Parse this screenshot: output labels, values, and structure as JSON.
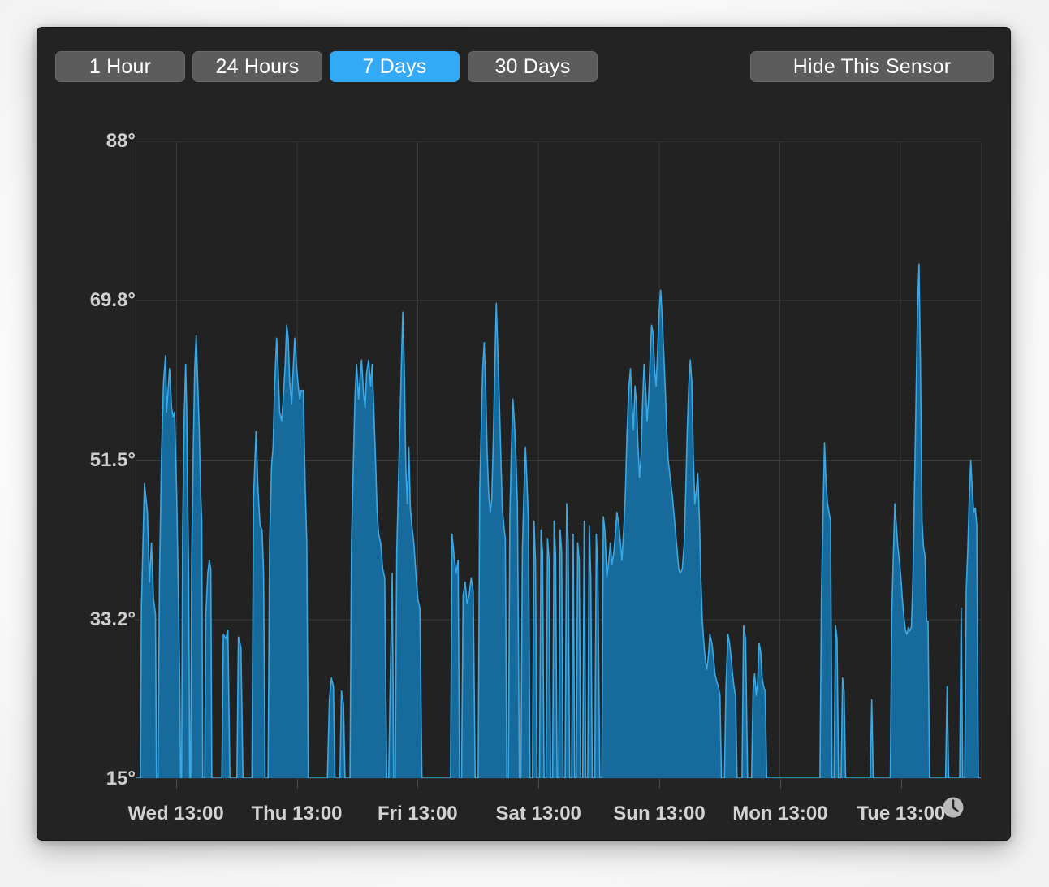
{
  "window": {
    "background_color": "#232323",
    "panel_color": "#222222"
  },
  "toolbar": {
    "range_buttons": [
      {
        "label": "1 Hour",
        "active": false
      },
      {
        "label": "24 Hours",
        "active": false
      },
      {
        "label": "7 Days",
        "active": true
      },
      {
        "label": "30 Days",
        "active": false
      }
    ],
    "hide_sensor_label": "Hide This Sensor",
    "active_color": "#34aaf6",
    "inactive_color": "#5c5c5c"
  },
  "chart_data": {
    "type": "area",
    "title": "",
    "xlabel": "",
    "ylabel": "",
    "grid": true,
    "legend": "none",
    "series_fill_color": "#176a9c",
    "series_line_color": "#3aa8e4",
    "ylim": [
      15,
      88
    ],
    "ytick_labels": [
      "88°",
      "69.8°",
      "51.5°",
      "33.2°",
      "15°"
    ],
    "ytick_values": [
      88,
      69.8,
      51.5,
      33.2,
      15
    ],
    "xtick_labels": [
      "Wed 13:00",
      "Thu 13:00",
      "Fri 13:00",
      "Sat 13:00",
      "Sun 13:00",
      "Mon 13:00",
      "Tue 13:00"
    ],
    "xtick_positions": [
      0.0476,
      0.1905,
      0.3333,
      0.4762,
      0.619,
      0.7619,
      0.9048
    ],
    "x_units": "hours since Wed 00:00",
    "xlim": [
      0,
      168
    ],
    "baseline": 15,
    "points": [
      [
        0.0,
        15
      ],
      [
        0.8,
        15
      ],
      [
        1.0,
        34.5
      ],
      [
        1.6,
        48.8
      ],
      [
        2.2,
        45.5
      ],
      [
        2.6,
        37.5
      ],
      [
        3.0,
        42.0
      ],
      [
        3.4,
        35.6
      ],
      [
        3.8,
        33.8
      ],
      [
        4.0,
        15
      ],
      [
        4.3,
        15
      ],
      [
        4.6,
        38.0
      ],
      [
        5.0,
        52.0
      ],
      [
        5.4,
        60.5
      ],
      [
        5.8,
        63.5
      ],
      [
        6.0,
        57.0
      ],
      [
        6.3,
        59.5
      ],
      [
        6.6,
        62.0
      ],
      [
        7.0,
        57.5
      ],
      [
        7.3,
        56.5
      ],
      [
        7.6,
        57.0
      ],
      [
        8.0,
        48.0
      ],
      [
        8.3,
        38.0
      ],
      [
        8.6,
        27.0
      ],
      [
        8.8,
        15
      ],
      [
        9.0,
        15
      ],
      [
        9.2,
        43.0
      ],
      [
        9.5,
        56.0
      ],
      [
        9.8,
        62.5
      ],
      [
        10.0,
        57.5
      ],
      [
        10.2,
        47.5
      ],
      [
        10.4,
        38.0
      ],
      [
        10.6,
        15
      ],
      [
        10.8,
        15
      ],
      [
        11.0,
        40.0
      ],
      [
        11.3,
        52.0
      ],
      [
        11.6,
        62.0
      ],
      [
        11.9,
        65.8
      ],
      [
        12.2,
        60.5
      ],
      [
        12.5,
        55.0
      ],
      [
        12.8,
        47.5
      ],
      [
        13.0,
        44.5
      ],
      [
        13.2,
        15
      ],
      [
        13.6,
        15
      ],
      [
        13.8,
        33.5
      ],
      [
        14.2,
        38.5
      ],
      [
        14.5,
        40.0
      ],
      [
        14.8,
        39.0
      ],
      [
        15.0,
        15
      ],
      [
        17.0,
        15
      ],
      [
        17.3,
        31.5
      ],
      [
        17.8,
        31.0
      ],
      [
        18.2,
        32.0
      ],
      [
        18.6,
        15
      ],
      [
        20.0,
        15
      ],
      [
        20.3,
        31.2
      ],
      [
        20.8,
        30.0
      ],
      [
        21.2,
        15
      ],
      [
        23.0,
        15
      ],
      [
        23.3,
        47.0
      ],
      [
        23.8,
        54.8
      ],
      [
        24.2,
        48.0
      ],
      [
        24.6,
        44.0
      ],
      [
        25.0,
        43.5
      ],
      [
        25.3,
        38.5
      ],
      [
        25.6,
        15
      ],
      [
        26.2,
        15
      ],
      [
        26.5,
        42.0
      ],
      [
        26.9,
        51.0
      ],
      [
        27.2,
        53.0
      ],
      [
        27.5,
        60.0
      ],
      [
        27.9,
        65.5
      ],
      [
        28.2,
        62.0
      ],
      [
        28.5,
        57.0
      ],
      [
        28.9,
        56.0
      ],
      [
        29.2,
        58.5
      ],
      [
        29.6,
        62.5
      ],
      [
        29.9,
        67.0
      ],
      [
        30.2,
        65.5
      ],
      [
        30.5,
        60.5
      ],
      [
        30.9,
        58.0
      ],
      [
        31.2,
        62.0
      ],
      [
        31.5,
        65.5
      ],
      [
        31.9,
        62.0
      ],
      [
        32.2,
        60.0
      ],
      [
        32.5,
        58.5
      ],
      [
        32.8,
        59.5
      ],
      [
        33.2,
        59.5
      ],
      [
        33.6,
        48.0
      ],
      [
        33.9,
        42.0
      ],
      [
        34.2,
        15
      ],
      [
        38.0,
        15
      ],
      [
        38.4,
        24.0
      ],
      [
        38.8,
        26.5
      ],
      [
        39.2,
        25.5
      ],
      [
        39.5,
        15
      ],
      [
        40.5,
        15
      ],
      [
        40.8,
        25.0
      ],
      [
        41.2,
        23.5
      ],
      [
        41.5,
        15
      ],
      [
        42.5,
        15
      ],
      [
        42.8,
        42.0
      ],
      [
        43.2,
        52.0
      ],
      [
        43.5,
        59.0
      ],
      [
        43.8,
        62.5
      ],
      [
        44.2,
        58.5
      ],
      [
        44.5,
        61.0
      ],
      [
        44.8,
        63.0
      ],
      [
        45.2,
        59.0
      ],
      [
        45.5,
        57.5
      ],
      [
        45.8,
        61.5
      ],
      [
        46.2,
        63.0
      ],
      [
        46.6,
        60.0
      ],
      [
        46.9,
        62.5
      ],
      [
        47.2,
        58.0
      ],
      [
        47.6,
        51.0
      ],
      [
        47.9,
        45.5
      ],
      [
        48.2,
        43.0
      ],
      [
        48.6,
        42.0
      ],
      [
        49.0,
        39.0
      ],
      [
        49.4,
        38.0
      ],
      [
        49.8,
        15
      ],
      [
        50.2,
        15
      ],
      [
        50.5,
        26.0
      ],
      [
        50.9,
        38.5
      ],
      [
        51.2,
        15
      ],
      [
        51.5,
        15
      ],
      [
        51.8,
        41.0
      ],
      [
        52.1,
        48.0
      ],
      [
        52.4,
        55.0
      ],
      [
        52.7,
        62.0
      ],
      [
        53.0,
        68.5
      ],
      [
        53.3,
        62.0
      ],
      [
        53.6,
        50.5
      ],
      [
        53.9,
        46.5
      ],
      [
        54.2,
        53.0
      ],
      [
        54.5,
        46.0
      ],
      [
        54.8,
        44.0
      ],
      [
        55.2,
        42.0
      ],
      [
        55.6,
        38.5
      ],
      [
        56.0,
        35.5
      ],
      [
        56.4,
        34.5
      ],
      [
        56.8,
        15
      ],
      [
        62.5,
        15
      ],
      [
        62.8,
        43.0
      ],
      [
        63.2,
        40.5
      ],
      [
        63.6,
        38.5
      ],
      [
        64.0,
        40.0
      ],
      [
        64.3,
        15
      ],
      [
        64.7,
        15
      ],
      [
        65.0,
        36.0
      ],
      [
        65.4,
        37.5
      ],
      [
        65.8,
        35.0
      ],
      [
        66.2,
        36.0
      ],
      [
        66.6,
        38.0
      ],
      [
        67.0,
        36.5
      ],
      [
        67.4,
        15
      ],
      [
        68.0,
        15
      ],
      [
        68.3,
        48.0
      ],
      [
        68.6,
        55.0
      ],
      [
        68.9,
        62.0
      ],
      [
        69.2,
        65.0
      ],
      [
        69.5,
        59.5
      ],
      [
        69.8,
        52.0
      ],
      [
        70.1,
        47.5
      ],
      [
        70.4,
        45.5
      ],
      [
        70.7,
        47.0
      ],
      [
        71.0,
        53.5
      ],
      [
        71.3,
        62.0
      ],
      [
        71.6,
        69.5
      ],
      [
        71.9,
        64.0
      ],
      [
        72.2,
        58.5
      ],
      [
        72.5,
        52.0
      ],
      [
        72.8,
        46.0
      ],
      [
        73.1,
        44.0
      ],
      [
        73.4,
        42.5
      ],
      [
        73.7,
        15
      ],
      [
        74.0,
        15
      ],
      [
        74.3,
        45.0
      ],
      [
        74.6,
        52.5
      ],
      [
        74.9,
        58.5
      ],
      [
        75.2,
        56.0
      ],
      [
        75.5,
        52.0
      ],
      [
        75.8,
        46.5
      ],
      [
        76.2,
        15
      ],
      [
        76.5,
        15
      ],
      [
        76.8,
        41.5
      ],
      [
        77.1,
        47.5
      ],
      [
        77.4,
        53.0
      ],
      [
        77.7,
        49.0
      ],
      [
        78.0,
        44.5
      ],
      [
        78.3,
        15
      ],
      [
        78.8,
        15
      ],
      [
        79.1,
        44.5
      ],
      [
        79.4,
        40.0
      ],
      [
        79.7,
        15
      ],
      [
        80.2,
        15
      ],
      [
        80.5,
        43.5
      ],
      [
        80.8,
        41.0
      ],
      [
        81.1,
        15
      ],
      [
        81.5,
        15
      ],
      [
        81.8,
        42.5
      ],
      [
        82.1,
        40.0
      ],
      [
        82.4,
        15
      ],
      [
        82.8,
        15
      ],
      [
        83.1,
        44.5
      ],
      [
        83.4,
        40.5
      ],
      [
        83.7,
        15
      ],
      [
        84.0,
        15
      ],
      [
        84.3,
        43.5
      ],
      [
        84.6,
        41.0
      ],
      [
        84.9,
        15
      ],
      [
        85.3,
        15
      ],
      [
        85.6,
        46.5
      ],
      [
        85.9,
        42.0
      ],
      [
        86.2,
        15
      ],
      [
        86.6,
        15
      ],
      [
        86.9,
        43.0
      ],
      [
        87.2,
        15
      ],
      [
        87.5,
        15
      ],
      [
        87.8,
        42.0
      ],
      [
        88.1,
        40.0
      ],
      [
        88.4,
        15
      ],
      [
        88.8,
        15
      ],
      [
        89.1,
        44.5
      ],
      [
        89.4,
        15
      ],
      [
        89.8,
        15
      ],
      [
        90.1,
        44.0
      ],
      [
        90.4,
        38.0
      ],
      [
        90.7,
        15
      ],
      [
        91.2,
        15
      ],
      [
        91.5,
        43.0
      ],
      [
        91.8,
        39.0
      ],
      [
        92.2,
        15
      ],
      [
        92.6,
        15
      ],
      [
        92.9,
        45.0
      ],
      [
        93.2,
        43.5
      ],
      [
        93.6,
        38.0
      ],
      [
        94.0,
        40.0
      ],
      [
        94.3,
        42.0
      ],
      [
        94.6,
        39.5
      ],
      [
        95.0,
        41.0
      ],
      [
        95.3,
        43.0
      ],
      [
        95.6,
        45.5
      ],
      [
        96.0,
        44.0
      ],
      [
        96.3,
        42.0
      ],
      [
        96.6,
        40.0
      ],
      [
        97.0,
        44.0
      ],
      [
        97.3,
        48.0
      ],
      [
        97.6,
        54.5
      ],
      [
        98.0,
        60.0
      ],
      [
        98.3,
        62.0
      ],
      [
        98.6,
        58.0
      ],
      [
        98.9,
        55.0
      ],
      [
        99.2,
        60.0
      ],
      [
        99.5,
        58.0
      ],
      [
        99.8,
        53.0
      ],
      [
        100.1,
        49.5
      ],
      [
        100.4,
        52.0
      ],
      [
        100.7,
        58.0
      ],
      [
        101.0,
        62.5
      ],
      [
        101.3,
        60.0
      ],
      [
        101.6,
        56.0
      ],
      [
        101.9,
        58.5
      ],
      [
        102.2,
        63.0
      ],
      [
        102.5,
        67.0
      ],
      [
        102.8,
        66.0
      ],
      [
        103.1,
        62.0
      ],
      [
        103.4,
        60.0
      ],
      [
        103.7,
        64.0
      ],
      [
        104.0,
        68.5
      ],
      [
        104.3,
        71.0
      ],
      [
        104.6,
        68.0
      ],
      [
        104.9,
        64.0
      ],
      [
        105.2,
        60.0
      ],
      [
        105.5,
        55.0
      ],
      [
        105.8,
        51.5
      ],
      [
        106.1,
        50.0
      ],
      [
        106.4,
        48.5
      ],
      [
        106.7,
        47.0
      ],
      [
        107.0,
        45.0
      ],
      [
        107.3,
        43.0
      ],
      [
        107.6,
        41.0
      ],
      [
        107.9,
        39.0
      ],
      [
        108.2,
        38.5
      ],
      [
        108.6,
        39.0
      ],
      [
        109.0,
        42.0
      ],
      [
        109.3,
        48.0
      ],
      [
        109.6,
        55.0
      ],
      [
        109.9,
        60.0
      ],
      [
        110.2,
        63.0
      ],
      [
        110.5,
        60.5
      ],
      [
        110.8,
        52.0
      ],
      [
        111.1,
        46.5
      ],
      [
        111.4,
        48.0
      ],
      [
        111.7,
        50.0
      ],
      [
        112.0,
        45.0
      ],
      [
        112.3,
        38.0
      ],
      [
        112.6,
        33.0
      ],
      [
        112.9,
        30.5
      ],
      [
        113.2,
        28.5
      ],
      [
        113.5,
        27.5
      ],
      [
        113.8,
        29.0
      ],
      [
        114.1,
        31.5
      ],
      [
        114.5,
        30.5
      ],
      [
        114.8,
        29.0
      ],
      [
        115.1,
        27.0
      ],
      [
        115.5,
        26.0
      ],
      [
        115.8,
        25.5
      ],
      [
        116.1,
        24.5
      ],
      [
        116.4,
        15
      ],
      [
        117.0,
        15
      ],
      [
        117.3,
        25.5
      ],
      [
        117.7,
        31.5
      ],
      [
        118.0,
        30.5
      ],
      [
        118.3,
        29.0
      ],
      [
        118.6,
        27.0
      ],
      [
        118.9,
        25.5
      ],
      [
        119.2,
        24.5
      ],
      [
        119.5,
        15
      ],
      [
        120.5,
        15
      ],
      [
        120.8,
        32.5
      ],
      [
        121.2,
        31.0
      ],
      [
        121.6,
        15
      ],
      [
        122.4,
        15
      ],
      [
        122.7,
        25.0
      ],
      [
        123.0,
        27.0
      ],
      [
        123.3,
        24.5
      ],
      [
        123.6,
        26.0
      ],
      [
        123.9,
        30.5
      ],
      [
        124.2,
        29.5
      ],
      [
        124.5,
        26.5
      ],
      [
        124.8,
        25.5
      ],
      [
        125.1,
        25.0
      ],
      [
        125.4,
        15
      ],
      [
        136.0,
        15
      ],
      [
        136.3,
        36.0
      ],
      [
        136.6,
        45.0
      ],
      [
        136.9,
        53.5
      ],
      [
        137.2,
        49.0
      ],
      [
        137.5,
        46.5
      ],
      [
        137.8,
        45.5
      ],
      [
        138.1,
        44.5
      ],
      [
        138.4,
        15
      ],
      [
        138.8,
        15
      ],
      [
        139.1,
        32.5
      ],
      [
        139.4,
        31.0
      ],
      [
        139.7,
        15
      ],
      [
        140.2,
        15
      ],
      [
        140.5,
        26.5
      ],
      [
        140.8,
        25.0
      ],
      [
        141.1,
        15
      ],
      [
        146.0,
        15
      ],
      [
        146.3,
        24.0
      ],
      [
        146.6,
        15
      ],
      [
        150.0,
        15
      ],
      [
        150.3,
        34.0
      ],
      [
        150.6,
        40.5
      ],
      [
        150.9,
        46.5
      ],
      [
        151.2,
        44.0
      ],
      [
        151.5,
        41.5
      ],
      [
        151.8,
        40.0
      ],
      [
        152.1,
        38.0
      ],
      [
        152.4,
        35.5
      ],
      [
        152.7,
        33.5
      ],
      [
        153.0,
        32.0
      ],
      [
        153.3,
        31.5
      ],
      [
        153.6,
        32.3
      ],
      [
        153.9,
        31.9
      ],
      [
        154.2,
        32.4
      ],
      [
        154.5,
        38.0
      ],
      [
        154.8,
        48.0
      ],
      [
        155.1,
        58.0
      ],
      [
        155.4,
        68.5
      ],
      [
        155.7,
        74.0
      ],
      [
        156.0,
        62.0
      ],
      [
        156.3,
        44.5
      ],
      [
        156.6,
        41.5
      ],
      [
        156.9,
        40.5
      ],
      [
        157.2,
        33.0
      ],
      [
        157.5,
        33.0
      ],
      [
        157.8,
        15
      ],
      [
        161.0,
        15
      ],
      [
        161.3,
        25.5
      ],
      [
        161.6,
        15
      ],
      [
        163.8,
        15
      ],
      [
        164.1,
        34.5
      ],
      [
        164.4,
        15
      ],
      [
        164.8,
        15
      ],
      [
        165.1,
        36.5
      ],
      [
        165.4,
        41.0
      ],
      [
        165.7,
        47.0
      ],
      [
        166.0,
        51.5
      ],
      [
        166.3,
        48.0
      ],
      [
        166.6,
        45.5
      ],
      [
        166.9,
        46.0
      ],
      [
        167.2,
        44.0
      ],
      [
        167.5,
        15
      ],
      [
        168.0,
        15
      ]
    ]
  },
  "footer": {
    "clock_icon": "clock-icon"
  }
}
